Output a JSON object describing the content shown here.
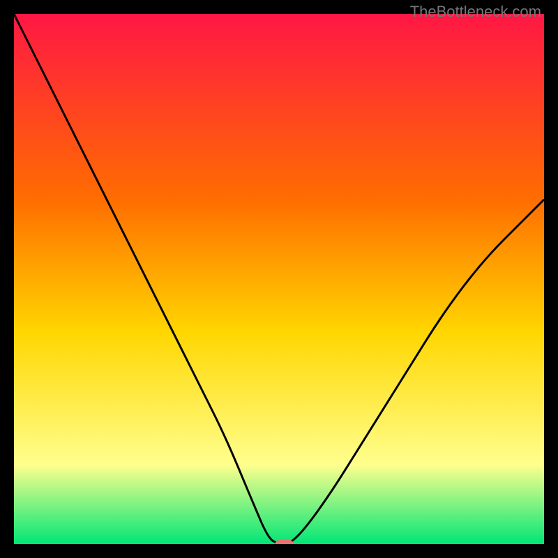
{
  "watermark": "TheBottleneck.com",
  "chart_data": {
    "type": "line",
    "title": "",
    "xlabel": "",
    "ylabel": "",
    "xlim": [
      0,
      100
    ],
    "ylim": [
      0,
      100
    ],
    "grid": false,
    "legend": false,
    "gradient_colors": {
      "top": "#ff1744",
      "mid_top": "#ff6d00",
      "mid": "#ffd600",
      "mid_low": "#ffff8d",
      "low": "#00e676"
    },
    "series": [
      {
        "name": "curve",
        "color": "#000000",
        "x": [
          0,
          5,
          10,
          15,
          20,
          25,
          30,
          35,
          40,
          45,
          48,
          50,
          52,
          55,
          60,
          65,
          70,
          75,
          80,
          85,
          90,
          95,
          100
        ],
        "y": [
          100,
          90,
          80,
          70,
          60,
          50,
          40,
          30,
          20,
          8,
          1,
          0,
          0,
          3,
          10,
          18,
          26,
          34,
          42,
          49,
          55,
          60,
          65
        ]
      }
    ],
    "marker": {
      "x": 51,
      "y": 0,
      "color": "#e57373",
      "shape": "pill"
    }
  }
}
